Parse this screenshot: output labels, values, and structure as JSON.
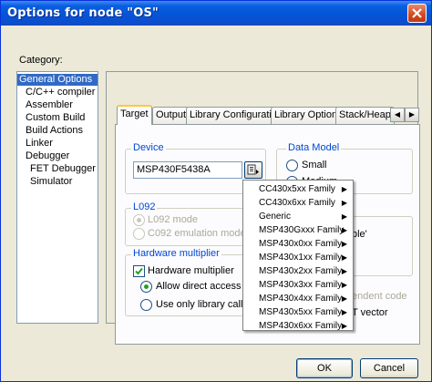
{
  "window": {
    "title": "Options for node \"OS\""
  },
  "category": {
    "label": "Category:",
    "items": [
      {
        "label": "General Options",
        "selected": true
      },
      {
        "label": "C/C++ compiler"
      },
      {
        "label": "Assembler"
      },
      {
        "label": "Custom Build"
      },
      {
        "label": "Build Actions"
      },
      {
        "label": "Linker"
      },
      {
        "label": "Debugger"
      },
      {
        "label": "FET Debugger"
      },
      {
        "label": "Simulator"
      }
    ]
  },
  "tabs": [
    "Target",
    "Output",
    "Library Configuration",
    "Library Options",
    "Stack/Heap"
  ],
  "tab_scroll": {
    "left": "◀",
    "right": "▶"
  },
  "device": {
    "title": "Device",
    "value": "MSP430F5438A"
  },
  "data_model": {
    "title": "Data Model",
    "options": [
      "Small",
      "Medium"
    ],
    "partial_text_1": "ble'",
    "partial_text_2": "endent code",
    "partial_text_3": "T vector"
  },
  "l092": {
    "title": "L092",
    "options": [
      "L092 mode",
      "C092 emulation mode"
    ],
    "selected_index": 0
  },
  "hw_multiplier": {
    "title": "Hardware multiplier",
    "checkbox_label": "Hardware multiplier",
    "checked": true,
    "options": [
      "Allow direct access",
      "Use only library calls"
    ],
    "selected_index": 0
  },
  "device_menu": {
    "items": [
      "CC430x5xx Family",
      "CC430x6xx Family",
      "Generic",
      "MSP430Gxxx Family",
      "MSP430x0xx Family",
      "MSP430x1xx Family",
      "MSP430x2xx Family",
      "MSP430x3xx Family",
      "MSP430x4xx Family",
      "MSP430x5xx Family",
      "MSP430x6xx Family"
    ],
    "submenu_arrow": "▶"
  },
  "buttons": {
    "ok": "OK",
    "cancel": "Cancel"
  },
  "colors": {
    "title_bar": "#0554d8",
    "selection": "#316ac5",
    "group_title": "#0046d5"
  }
}
